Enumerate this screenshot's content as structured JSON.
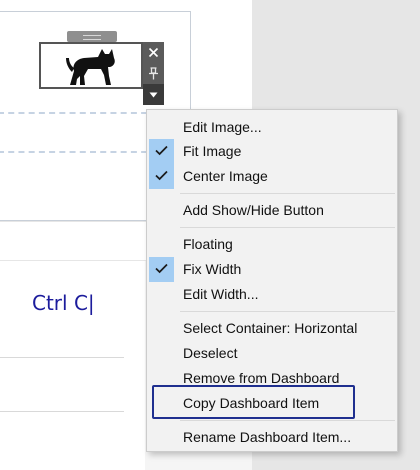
{
  "image_object": {
    "image_icon": "cat-silhouette-icon",
    "toolbar": {
      "close_icon": "close-icon",
      "pin_icon": "pin-icon",
      "menu_icon": "caret-down-icon"
    }
  },
  "text_object": {
    "value": "Ctrl C|"
  },
  "context_menu": {
    "items": [
      {
        "label": "Edit Image...",
        "checked": false
      },
      {
        "label": "Fit Image",
        "checked": true
      },
      {
        "label": "Center Image",
        "checked": true
      },
      {
        "label": "Add Show/Hide Button",
        "checked": false
      },
      {
        "label": "Floating",
        "checked": false
      },
      {
        "label": "Fix Width",
        "checked": true
      },
      {
        "label": "Edit Width...",
        "checked": false
      },
      {
        "label": "Select Container: Horizontal",
        "checked": false
      },
      {
        "label": "Deselect",
        "checked": false
      },
      {
        "label": "Remove from Dashboard",
        "checked": false
      },
      {
        "label": "Copy Dashboard Item",
        "checked": false,
        "focused": true
      },
      {
        "label": "Rename Dashboard Item...",
        "checked": false
      }
    ]
  },
  "colors": {
    "check_highlight": "#a3cdf3",
    "focus_outline": "#1f2f8f",
    "typed_text": "#1c1c9c",
    "toolbar": "#5b5b5b"
  }
}
